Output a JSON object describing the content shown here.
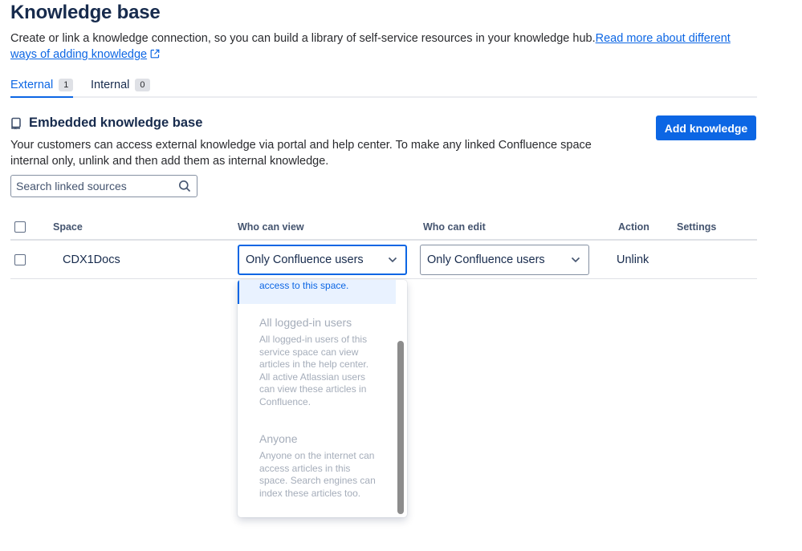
{
  "page": {
    "title": "Knowledge base",
    "description": "Create or link a knowledge connection, so you can build a library of self-service resources in your knowledge hub.",
    "link_line1": "Read more about different",
    "link_line2": "ways of adding knowledge"
  },
  "tabs": [
    {
      "label": "External",
      "count": "1",
      "active": true
    },
    {
      "label": "Internal",
      "count": "0",
      "active": false
    }
  ],
  "section": {
    "icon": "book-icon",
    "title": "Embedded knowledge base",
    "description": "Your customers can access external knowledge via portal and help center. To make any linked Confluence space internal only, unlink and then add them as internal knowledge.",
    "add_button": "Add knowledge"
  },
  "search": {
    "placeholder": "Search linked sources"
  },
  "table": {
    "headers": {
      "space": "Space",
      "who_view": "Who can view",
      "who_edit": "Who can edit",
      "action": "Action",
      "settings": "Settings"
    },
    "rows": [
      {
        "space": "CDX1Docs",
        "who_view": "Only Confluence users",
        "who_edit": "Only Confluence users",
        "action": "Unlink"
      }
    ]
  },
  "dropdown": {
    "selected_partial_desc": "access to this space.",
    "options": [
      {
        "title": "All logged-in users",
        "desc_lines": [
          "All logged-in users of this",
          "service space can view",
          "articles in the help center.",
          "All active Atlassian users",
          "can view these articles in",
          "Confluence."
        ]
      },
      {
        "title": "Anyone",
        "desc_lines": [
          "Anyone on the internet can",
          "access articles in this",
          "space. Search engines can",
          "index these articles too."
        ]
      }
    ]
  },
  "colors": {
    "accent": "#0c66e4",
    "text": "#172b4d",
    "disabled": "#a5adba",
    "selected_bg": "#e9f2ff"
  }
}
